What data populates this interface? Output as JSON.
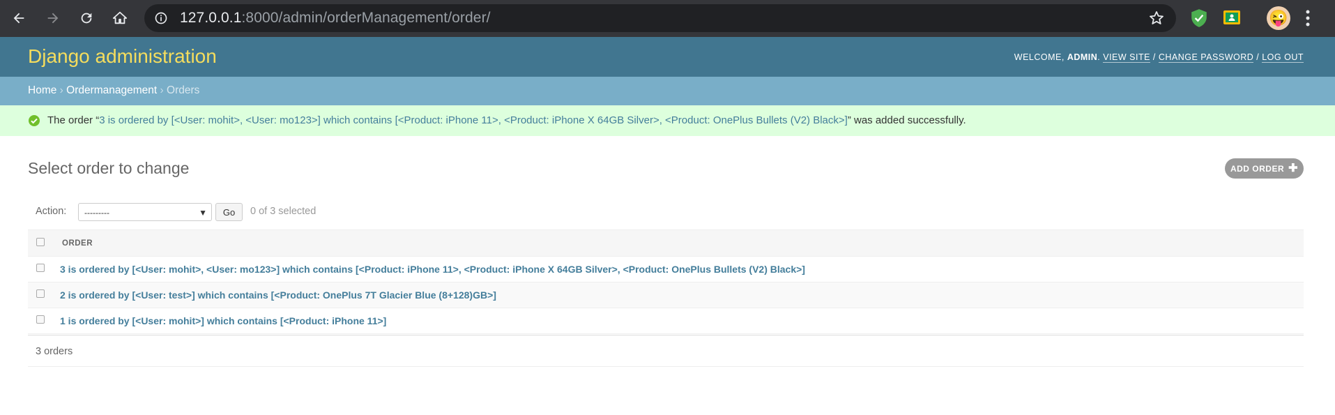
{
  "browser": {
    "url_host": "127.0.0.1",
    "url_rest": ":8000/admin/orderManagement/order/"
  },
  "header": {
    "brand": "Django administration",
    "welcome": "WELCOME,",
    "username": "ADMIN",
    "view_site": "VIEW SITE",
    "change_password": "CHANGE PASSWORD",
    "log_out": "LOG OUT",
    "brand_color": "#f5dd5d",
    "bar_color": "#417690"
  },
  "breadcrumbs": {
    "home": "Home",
    "app": "Ordermanagement",
    "current": "Orders"
  },
  "message": {
    "prefix": "The order “",
    "link": "3 is ordered by [<User: mohit>, <User: mo123>] which contains [<Product: iPhone 11>, <Product: iPhone X 64GB Silver>, <Product: OnePlus Bullets (V2) Black>]",
    "suffix": "” was added successfully."
  },
  "content": {
    "title": "Select order to change",
    "add_button": "ADD ORDER"
  },
  "actions": {
    "label": "Action:",
    "selected_option": "---------",
    "go": "Go",
    "count": "0 of 3 selected"
  },
  "table": {
    "header": "ORDER",
    "rows": [
      "3 is ordered by [<User: mohit>, <User: mo123>] which contains [<Product: iPhone 11>, <Product: iPhone X 64GB Silver>, <Product: OnePlus Bullets (V2) Black>]",
      "2 is ordered by [<User: test>] which contains [<Product: OnePlus 7T Glacier Blue (8+128)GB>]",
      "1 is ordered by [<User: mohit>] which contains [<Product: iPhone 11>]"
    ],
    "footer": "3 orders"
  }
}
